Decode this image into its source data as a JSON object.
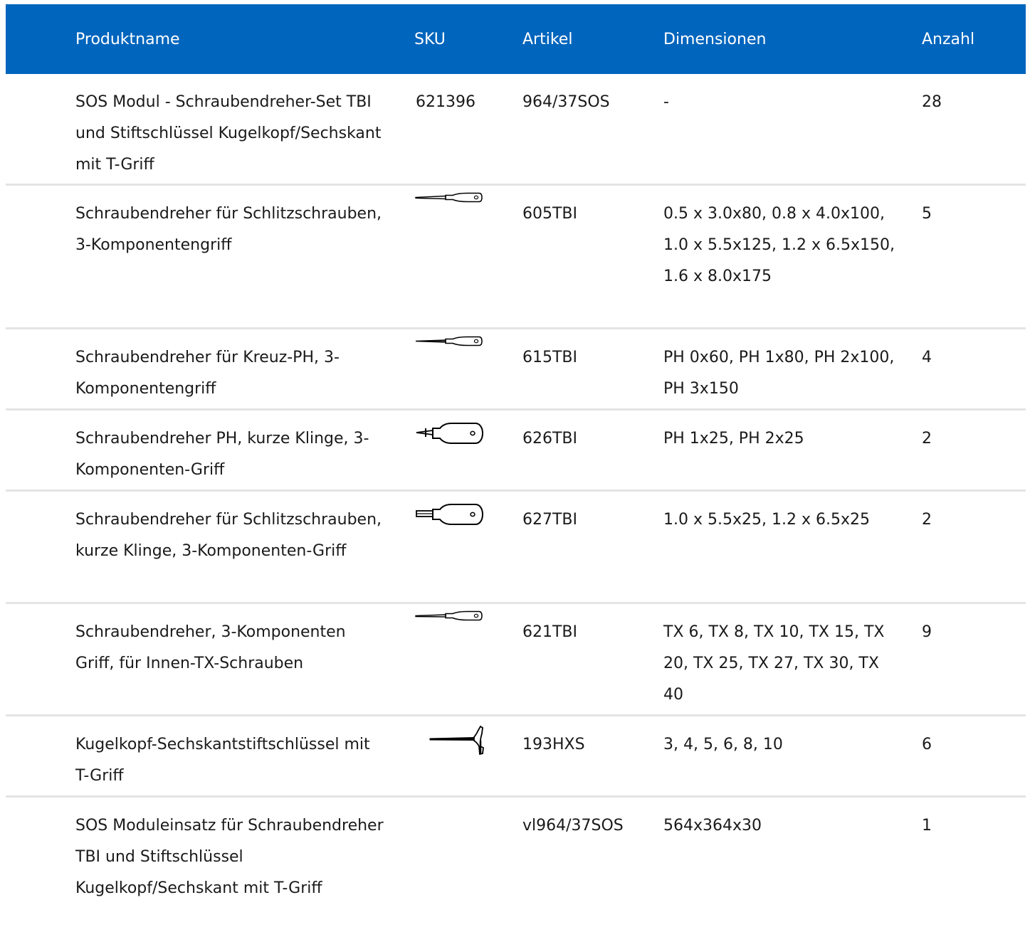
{
  "header": {
    "produktname": "Produktname",
    "sku": "SKU",
    "artikel": "Artikel",
    "dimensionen": "Dimensionen",
    "anzahl": "Anzahl"
  },
  "rows": [
    {
      "name": "SOS Modul - Schraubendreher-Set TBI und Stiftschlüssel Kugelkopf/Sechskant mit T-Griff",
      "sku": "621396",
      "icon": "",
      "artikel": "964/37SOS",
      "dimensionen": "-",
      "anzahl": "28"
    },
    {
      "name": "Schraubendreher für Schlitzschrauben, 3-Komponentengriff",
      "sku": "",
      "icon": "long-slotted-screwdriver-icon",
      "artikel": "605TBI",
      "dimensionen": "0.5 x 3.0x80, 0.8 x 4.0x100, 1.0 x 5.5x125, 1.2 x 6.5x150, 1.6 x 8.0x175",
      "anzahl": "5"
    },
    {
      "name": "Schraubendreher für Kreuz-PH, 3-Komponentengriff",
      "sku": "",
      "icon": "long-phillips-screwdriver-icon",
      "artikel": "615TBI",
      "dimensionen": "PH 0x60, PH 1x80, PH 2x100, PH 3x150",
      "anzahl": "4"
    },
    {
      "name": "Schraubendreher PH, kurze Klinge, 3-Komponenten-Griff",
      "sku": "",
      "icon": "stubby-phillips-screwdriver-icon",
      "artikel": "626TBI",
      "dimensionen": "PH 1x25, PH 2x25",
      "anzahl": "2"
    },
    {
      "name": "Schraubendreher für Schlitzschrauben, kurze Klinge, 3-Komponenten-Griff",
      "sku": "",
      "icon": "stubby-slotted-screwdriver-icon",
      "artikel": "627TBI",
      "dimensionen": "1.0 x 5.5x25, 1.2 x 6.5x25",
      "anzahl": "2"
    },
    {
      "name": "Schraubendreher, 3-Komponenten Griff, für Innen-TX-Schrauben",
      "sku": "",
      "icon": "long-torx-screwdriver-icon",
      "artikel": "621TBI",
      "dimensionen": "TX 6, TX 8, TX 10, TX 15, TX 20, TX 25, TX 27, TX 30, TX 40",
      "anzahl": "9"
    },
    {
      "name": "Kugelkopf-Sechskantstiftschlüssel mit T-Griff",
      "sku": "",
      "icon": "t-handle-hex-key-icon",
      "artikel": "193HXS",
      "dimensionen": "3, 4, 5, 6, 8, 10",
      "anzahl": "6"
    },
    {
      "name": "SOS Moduleinsatz für Schraubendreher TBI und Stiftschlüssel Kugelkopf/Sechskant mit T-Griff",
      "sku": "",
      "icon": "",
      "artikel": "vl964/37SOS",
      "dimensionen": "564x364x30",
      "anzahl": "1"
    }
  ],
  "colors": {
    "header_bg": "#0065bd",
    "header_text": "#ffffff",
    "divider": "#e4e4e4"
  }
}
